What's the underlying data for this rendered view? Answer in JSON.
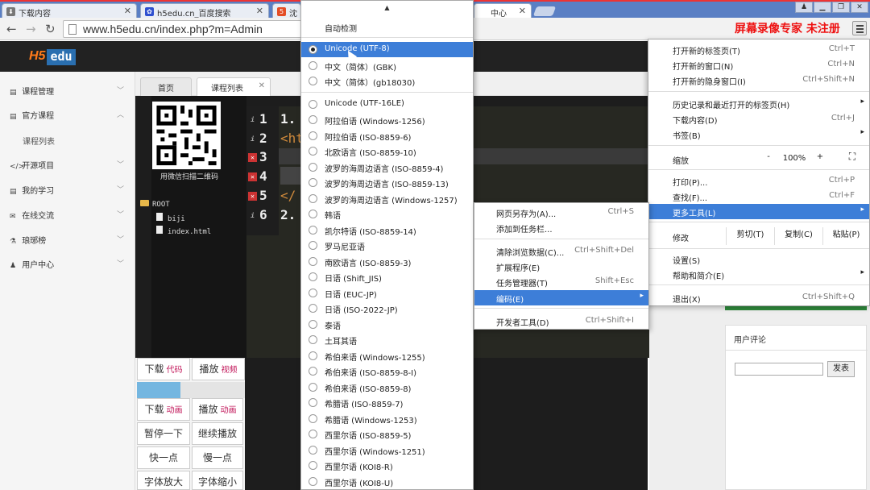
{
  "browser": {
    "tabs": [
      {
        "title": "下载内容",
        "icon": "download-icon"
      },
      {
        "title": "h5edu.cn_百度搜索",
        "icon": "baidu-paw-icon"
      },
      {
        "title": "沈",
        "icon": "html5-icon"
      },
      {
        "title": "中心",
        "icon": "page-icon"
      }
    ],
    "url": "www.h5edu.cn/index.php?m=Admin",
    "watermark": "屏幕录像专家 未注册",
    "window_controls": [
      "person-icon",
      "minimize-icon",
      "restore-icon",
      "close-icon"
    ]
  },
  "site": {
    "logo_h5": "H5",
    "logo_edu": "edu",
    "sidebar": [
      {
        "label": "课程管理",
        "icon": "book-icon"
      },
      {
        "label": "官方课程",
        "icon": "book-icon"
      },
      {
        "label": "课程列表",
        "icon": ""
      },
      {
        "label": "开源项目",
        "icon": "code-icon"
      },
      {
        "label": "我的学习",
        "icon": "book-icon"
      },
      {
        "label": "在线交流",
        "icon": "comments-icon"
      },
      {
        "label": "琅琊榜",
        "icon": "flask-icon"
      },
      {
        "label": "用户中心",
        "icon": "user-icon"
      }
    ],
    "page_tabs": [
      {
        "label": "首页",
        "closable": false
      },
      {
        "label": "课程列表",
        "closable": true
      }
    ],
    "qr_label": "用微信扫描二维码",
    "file_tree": {
      "root": "ROOT",
      "files": [
        "biji",
        "index.html"
      ]
    },
    "editor_lines": [
      {
        "num": "1",
        "marker": "i",
        "code": "1."
      },
      {
        "num": "2",
        "marker": "i",
        "code": "<ht"
      },
      {
        "num": "3",
        "marker": "x",
        "code": ""
      },
      {
        "num": "4",
        "marker": "x",
        "code": ""
      },
      {
        "num": "5",
        "marker": "x",
        "code": "</"
      },
      {
        "num": "6",
        "marker": "i",
        "code": "2."
      }
    ],
    "controls": {
      "download_code": "下载",
      "download_code_acc": "代码",
      "play_video": "播放",
      "play_video_acc": "视频",
      "download_anim": "下载",
      "download_anim_acc": "动画",
      "play_anim": "播放",
      "play_anim_acc": "动画",
      "pause": "暂停一下",
      "resume": "继续播放",
      "faster": "快一点",
      "slower": "慢一点",
      "font_bigger": "字体放大",
      "font_smaller": "字体缩小",
      "progress": 0.4
    },
    "comments": {
      "title": "用户评论",
      "submit": "发表"
    }
  },
  "encoding_menu": {
    "scroll_up": "▲",
    "auto_detect": "自动检测",
    "selected_index": 0,
    "items": [
      "Unicode (UTF-8)",
      "中文（简体）(GBK)",
      "中文（简体）(gb18030)",
      "Unicode (UTF-16LE)",
      "阿拉伯语 (Windows-1256)",
      "阿拉伯语 (ISO-8859-6)",
      "北欧语言 (ISO-8859-10)",
      "波罗的海周边语言 (ISO-8859-4)",
      "波罗的海周边语言 (ISO-8859-13)",
      "波罗的海周边语言 (Windows-1257)",
      "韩语",
      "凯尔特语 (ISO-8859-14)",
      "罗马尼亚语",
      "南欧语言 (ISO-8859-3)",
      "日语 (Shift_JIS)",
      "日语 (EUC-JP)",
      "日语 (ISO-2022-JP)",
      "泰语",
      "土耳其语",
      "希伯来语 (Windows-1255)",
      "希伯来语 (ISO-8859-8-I)",
      "希伯来语 (ISO-8859-8)",
      "希腊语 (ISO-8859-7)",
      "希腊语 (Windows-1253)",
      "西里尔语 (ISO-8859-5)",
      "西里尔语 (Windows-1251)",
      "西里尔语 (KOI8-R)",
      "西里尔语 (KOI8-U)"
    ]
  },
  "main_menu": {
    "new_tab": {
      "label": "打开新的标签页(T)",
      "shortcut": "Ctrl+T"
    },
    "new_window": {
      "label": "打开新的窗口(N)",
      "shortcut": "Ctrl+N"
    },
    "incognito": {
      "label": "打开新的隐身窗口(I)",
      "shortcut": "Ctrl+Shift+N"
    },
    "history": {
      "label": "历史记录和最近打开的标签页(H)"
    },
    "downloads": {
      "label": "下载内容(D)",
      "shortcut": "Ctrl+J"
    },
    "bookmarks": {
      "label": "书签(B)"
    },
    "zoom_label": "缩放",
    "zoom_minus": "-",
    "zoom_value": "100%",
    "zoom_plus": "+",
    "print": {
      "label": "打印(P)...",
      "shortcut": "Ctrl+P"
    },
    "find": {
      "label": "查找(F)...",
      "shortcut": "Ctrl+F"
    },
    "more_tools": {
      "label": "更多工具(L)"
    },
    "edit_label": "修改",
    "cut": "剪切(T)",
    "copy": "复制(C)",
    "paste": "粘贴(P)",
    "settings": {
      "label": "设置(S)"
    },
    "help": {
      "label": "帮助和简介(E)"
    },
    "exit": {
      "label": "退出(X)",
      "shortcut": "Ctrl+Shift+Q"
    }
  },
  "more_tools_menu": {
    "save_page": {
      "label": "网页另存为(A)...",
      "shortcut": "Ctrl+S"
    },
    "add_taskbar": {
      "label": "添加到任务栏..."
    },
    "clear_data": {
      "label": "清除浏览数据(C)...",
      "shortcut": "Ctrl+Shift+Del"
    },
    "extensions": {
      "label": "扩展程序(E)"
    },
    "task_manager": {
      "label": "任务管理器(T)",
      "shortcut": "Shift+Esc"
    },
    "encoding": {
      "label": "编码(E)"
    },
    "dev_tools": {
      "label": "开发者工具(D)",
      "shortcut": "Ctrl+Shift+I"
    }
  },
  "colors": {
    "accent": "#3d7ed8",
    "tabstrip": "#5a7fc4",
    "header": "#222222",
    "logo_orange": "#ff7a1a"
  }
}
